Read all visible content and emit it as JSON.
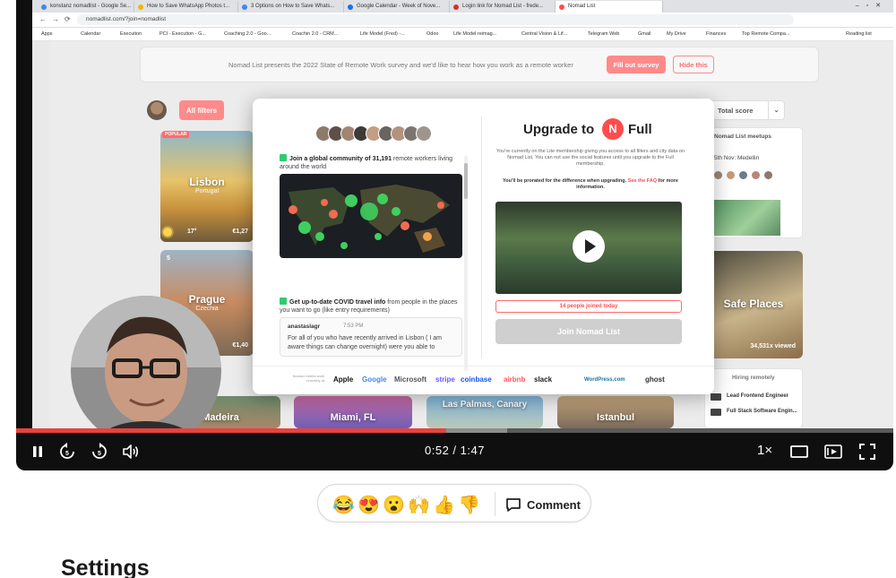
{
  "browser": {
    "tabs": [
      {
        "label": "konstanz nomadlist - Google Se..."
      },
      {
        "label": "How to Save WhatsApp Photos t..."
      },
      {
        "label": "3 Options on How to Save Whats..."
      },
      {
        "label": "Google Calendar - Week of Nove..."
      },
      {
        "label": "Login link for Nomad List - frede..."
      },
      {
        "label": "Nomad List"
      }
    ],
    "url": "nomadlist.com/?join=nomadlist",
    "bookmarks": [
      "Apps",
      "Calendar",
      "Execution",
      "PCI - Execution - G...",
      "Coaching 2.0 - Goo...",
      "Coachin 2.0 - CRM...",
      "Life Model (Fred) -...",
      "Odoo",
      "Life Model reimag...",
      "Central Vision & Lif...",
      "Telegram Web",
      "Gmail",
      "My Drive",
      "Finances",
      "Top Remote Compa...",
      "Reading list"
    ]
  },
  "nomad": {
    "banner_text": "Nomad List presents the 2022 State of Remote Work survey and we'd like to hear how you work as a remote worker",
    "fill_survey": "Fill out survey",
    "hide_this": "Hide this",
    "all_filters": "All filters",
    "sort_label": "Total score",
    "cities": [
      {
        "name": "Lisbon",
        "country": "Portugal",
        "temp": "17°",
        "price": "€1,27",
        "tag": "POPULAR",
        "rank": ""
      },
      {
        "name": "Prague",
        "country": "Czechia",
        "temp": "",
        "price": "€1,40",
        "tag": "",
        "rank": "5"
      },
      {
        "name": "Madeira",
        "country": "",
        "temp": "",
        "price": "",
        "tag": "",
        "rank": ""
      },
      {
        "name": "Miami, FL",
        "country": "",
        "temp": "",
        "price": "",
        "tag": "",
        "rank": ""
      },
      {
        "name": "Las Palmas, Canary",
        "country": "",
        "temp": "",
        "price": "",
        "tag": "",
        "rank": ""
      },
      {
        "name": "Istanbul",
        "country": "",
        "temp": "",
        "price": "",
        "tag": "",
        "rank": ""
      }
    ],
    "meetups": {
      "title": "Nomad List meetups",
      "line": "5th Nov: Medellin"
    },
    "safe_places": {
      "name": "Safe Places",
      "views": "34,531x viewed"
    },
    "hiring": {
      "title": "Hiring remotely",
      "jobs": [
        "Lead Frontend Engineer",
        "Full Stack Software Engin..."
      ]
    }
  },
  "modal": {
    "feature1_pre": "Join a global community of ",
    "feature1_count": "31,191",
    "feature1_post": " remote workers living around the world",
    "feature2_bold": "Get up-to-date COVID travel info",
    "feature2_rest": " from people in the places you want to go (like entry requirements)",
    "chat_user": "anastaslagr",
    "chat_time": "7:53 PM",
    "chat_msg": "For all of you who have recently arrived in Lisbon ( I am aware things can change overnight) were you able to",
    "upgrade_to": "Upgrade to",
    "badge_letter": "N",
    "full": "Full",
    "desc": "You're currently on the Lite membership giving you access to all filters and city data on Nomad List. You can not use the social features until you upgrade to the Full membership.",
    "prorated": "You'll be prorated for the difference when upgrading.",
    "faq_link": "See the FAQ",
    "faq_post": " for more information.",
    "joined_today": "14 people joined today",
    "join_button": "Join Nomad List",
    "logos_caption": "Nomad Listers work remotely at",
    "brands": [
      {
        "name": "Apple",
        "color": "#111111"
      },
      {
        "name": "Google",
        "color": "#4285f4"
      },
      {
        "name": "Microsoft",
        "color": "#555555"
      },
      {
        "name": "stripe",
        "color": "#635bff"
      },
      {
        "name": "coinbase",
        "color": "#1652f0"
      },
      {
        "name": "airbnb",
        "color": "#ff5a5f"
      },
      {
        "name": "slack",
        "color": "#222222"
      },
      {
        "name": "WordPress.com",
        "color": "#21759b"
      },
      {
        "name": "ghost",
        "color": "#333333"
      }
    ]
  },
  "player": {
    "time": "0:52 / 1:47",
    "speed": "1×",
    "progress": 0.49,
    "buffered": 0.56,
    "accent": "#e8433f",
    "icons": [
      "pause-icon",
      "rewind-5-icon",
      "forward-5-icon",
      "volume-icon",
      "theater-mode-icon",
      "picture-in-picture-icon",
      "fullscreen-icon"
    ]
  },
  "reactions": {
    "emojis": [
      "😂",
      "😍",
      "😮",
      "🙌",
      "👍",
      "👎"
    ],
    "comment_label": "Comment"
  },
  "settings_heading": "Settings"
}
